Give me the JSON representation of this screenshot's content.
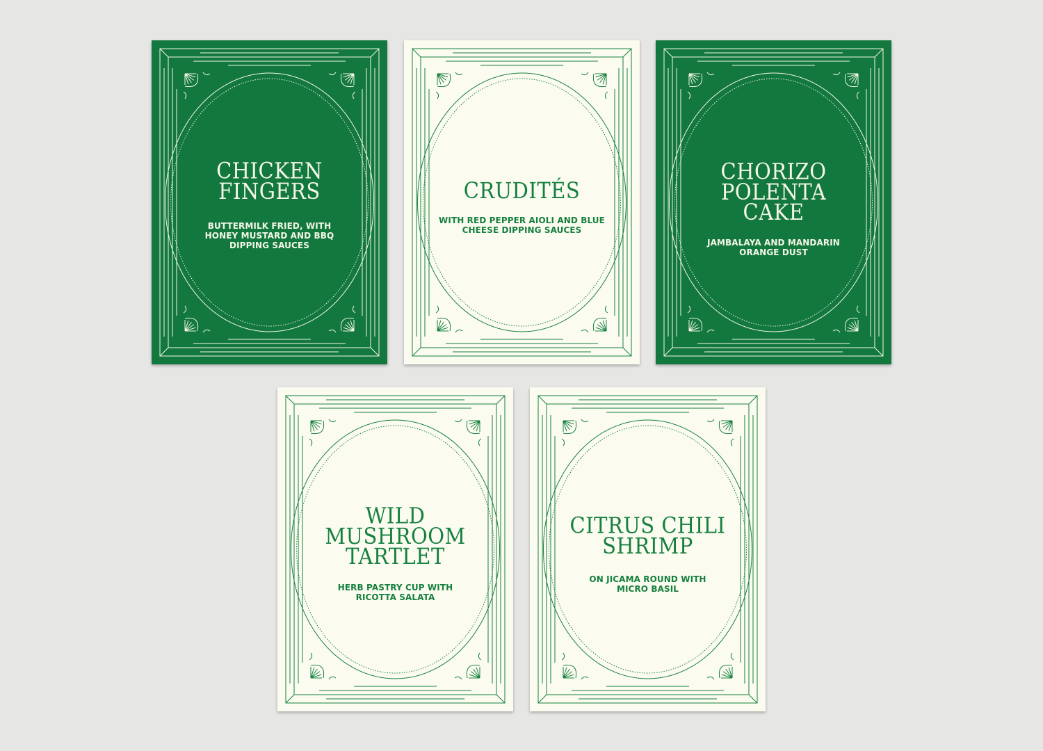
{
  "colors": {
    "background": "#e6e6e5",
    "green": "#13783d",
    "cream": "#fbfbef",
    "ink_on_green": "#f4f7e8",
    "ink_on_cream": "#16803f"
  },
  "cards": [
    {
      "title": "CHICKEN\nFINGERS",
      "description": "BUTTERMILK FRIED, WITH\nHONEY MUSTARD AND BBQ\nDIPPING SAUCES",
      "theme": "green"
    },
    {
      "title": "CRUDITÉS",
      "description": "WITH RED PEPPER AIOLI AND BLUE\nCHEESE DIPPING SAUCES",
      "theme": "cream"
    },
    {
      "title": "CHORIZO\nPOLENTA\nCAKE",
      "description": "JAMBALAYA AND MANDARIN\nORANGE DUST",
      "theme": "green"
    },
    {
      "title": "WILD\nMUSHROOM\nTARTLET",
      "description": "HERB PASTRY CUP WITH\nRICOTTA SALATA",
      "theme": "cream"
    },
    {
      "title": "CITRUS CHILI\nSHRIMP",
      "description": "ON JICAMA ROUND WITH\nMICRO BASIL",
      "theme": "cream"
    }
  ]
}
